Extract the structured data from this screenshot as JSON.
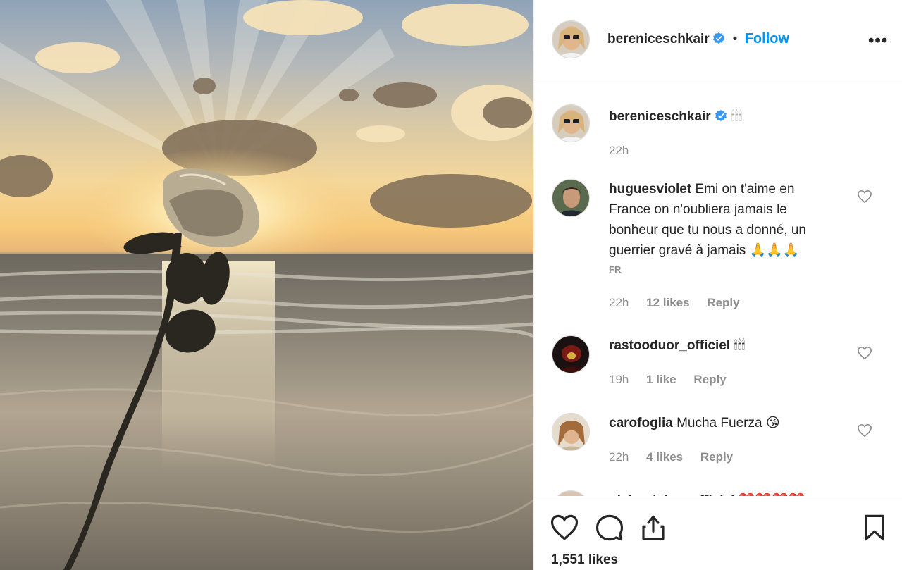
{
  "post": {
    "author": "bereniceschkair",
    "follow_label": "Follow",
    "separator": "•",
    "more_label": "•••"
  },
  "caption": {
    "username": "bereniceschkair",
    "text": "🕯🕯🕯",
    "time": "22h"
  },
  "comments": [
    {
      "username": "huguesviolet",
      "text_lines": [
        "Emi on t'aime en",
        "France on n'oubliera jamais le",
        "bonheur que tu nous a donné, un",
        "guerrier gravé à jamais 🙏🙏🙏"
      ],
      "translation_tag": "FR",
      "time": "22h",
      "likes": "12 likes",
      "reply": "Reply"
    },
    {
      "username": "rastooduor_officiel",
      "text": "🕯🕯🕯",
      "time": "19h",
      "likes": "1 like",
      "reply": "Reply"
    },
    {
      "username": "carofoglia",
      "text": "Mucha Fuerza 😘",
      "time": "22h",
      "likes": "4 likes",
      "reply": "Reply"
    },
    {
      "username": "olchantalgn_officiel",
      "text": "❤️❤️❤️❤️"
    }
  ],
  "footer": {
    "likes": "1,551 likes"
  },
  "colors": {
    "link_blue": "#0095f6",
    "verified_blue": "#3897f0",
    "meta_gray": "#8e8e8e"
  },
  "icons": [
    "heart-icon",
    "comment-icon",
    "share-icon",
    "bookmark-icon",
    "verified-icon",
    "more-icon"
  ]
}
